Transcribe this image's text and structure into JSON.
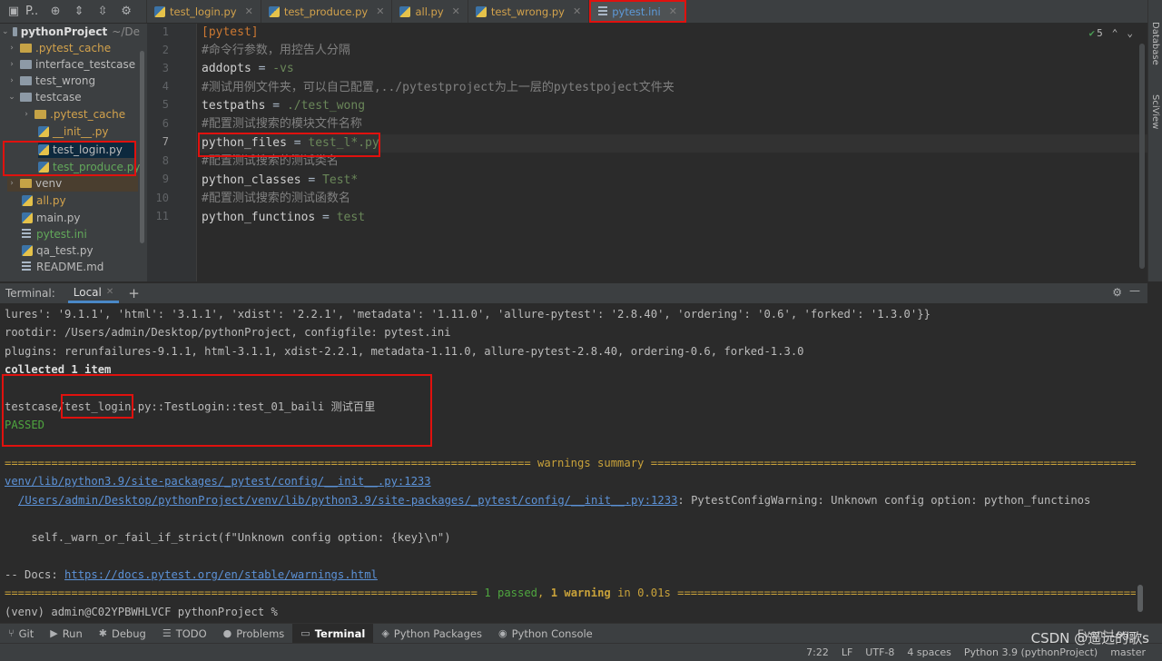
{
  "topbar": {
    "project_short": "P..",
    "tabs": [
      {
        "label": "test_login.py",
        "icon": "python-file-icon",
        "active": false
      },
      {
        "label": "test_produce.py",
        "icon": "python-file-icon",
        "active": false
      },
      {
        "label": "all.py",
        "icon": "python-file-icon",
        "active": false
      },
      {
        "label": "test_wrong.py",
        "icon": "python-file-icon",
        "active": false
      },
      {
        "label": "pytest.ini",
        "icon": "ini-file-icon",
        "active": true
      }
    ]
  },
  "right_strip": {
    "database": "Database",
    "sciview": "SciView"
  },
  "tree": {
    "root": "pythonProject",
    "root_path": "~/De",
    "items": [
      {
        "label": ".pytest_cache",
        "type": "folder-orange",
        "depth": 1,
        "expanded": false
      },
      {
        "label": "interface_testcase",
        "type": "folder",
        "depth": 1,
        "expanded": false
      },
      {
        "label": "test_wrong",
        "type": "folder",
        "depth": 1,
        "expanded": false
      },
      {
        "label": "testcase",
        "type": "folder",
        "depth": 1,
        "expanded": true
      },
      {
        "label": ".pytest_cache",
        "type": "folder-orange",
        "depth": 2,
        "expanded": false
      },
      {
        "label": "__init__.py",
        "type": "py",
        "depth": 2
      },
      {
        "label": "test_login.py",
        "type": "py",
        "depth": 2
      },
      {
        "label": "test_produce.py",
        "type": "py",
        "depth": 2
      },
      {
        "label": "venv",
        "type": "folder-orange",
        "depth": 1,
        "expanded": false
      },
      {
        "label": "all.py",
        "type": "py",
        "depth": 1
      },
      {
        "label": "main.py",
        "type": "py",
        "depth": 1
      },
      {
        "label": "pytest.ini",
        "type": "ini",
        "depth": 1
      },
      {
        "label": "qa_test.py",
        "type": "py",
        "depth": 1
      },
      {
        "label": "README.md",
        "type": "md",
        "depth": 1
      }
    ]
  },
  "editor": {
    "inspection_count": "5",
    "lines": [
      {
        "num": "1",
        "kind": "section",
        "text": "[pytest]"
      },
      {
        "num": "2",
        "kind": "comment",
        "text": "#命令行参数，用控告人分隔"
      },
      {
        "num": "3",
        "kind": "kv",
        "key": "addopts",
        "value": "-vs"
      },
      {
        "num": "4",
        "kind": "comment",
        "text": "#测试用例文件夹，可以自己配置,../pytestproject为上一层的pytestpoject文件夹"
      },
      {
        "num": "5",
        "kind": "kv",
        "key": "testpaths",
        "value": "./test_wong"
      },
      {
        "num": "6",
        "kind": "comment",
        "text": "#配置测试搜索的模块文件名称"
      },
      {
        "num": "7",
        "kind": "kv",
        "key": "python_files",
        "value": "test_l*.py"
      },
      {
        "num": "8",
        "kind": "comment",
        "text": "#配置测试搜索的测试类名"
      },
      {
        "num": "9",
        "kind": "kv",
        "key": "python_classes",
        "value": "Test*"
      },
      {
        "num": "10",
        "kind": "comment",
        "text": "#配置测试搜索的测试函数名"
      },
      {
        "num": "11",
        "kind": "kv",
        "key": "python_functinos",
        "value": "test"
      }
    ]
  },
  "terminal": {
    "label": "Terminal:",
    "tab": "Local",
    "lines": {
      "l1": "lures': '9.1.1', 'html': '3.1.1', 'xdist': '2.2.1', 'metadata': '1.11.0', 'allure-pytest': '2.8.40', 'ordering': '0.6', 'forked': '1.3.0'}}",
      "l2": "rootdir: /Users/admin/Desktop/pythonProject, configfile: pytest.ini",
      "l3": "plugins: rerunfailures-9.1.1, html-3.1.1, xdist-2.2.1, metadata-1.11.0, allure-pytest-2.8.40, ordering-0.6, forked-1.3.0",
      "l4": "collected 1 item",
      "l5_prefix": "testcase/",
      "l5_file": "test_login",
      "l5_rest": ".py::TestLogin::test_01_baili 测试百里",
      "l6": "PASSED",
      "warn_summary": "=============================================================================== warnings summary ===============================================================================",
      "warn_link1": "venv/lib/python3.9/site-packages/_pytest/config/__init__.py:1233",
      "warn_link2": "/Users/admin/Desktop/pythonProject/venv/lib/python3.9/site-packages/_pytest/config/__init__.py:1233",
      "warn_msg": ": PytestConfigWarning: Unknown config option: python_functinos",
      "warn_code": "    self._warn_or_fail_if_strict(f\"Unknown config option: {key}\\n\")",
      "docs_prefix": "-- Docs: ",
      "docs_link": "https://docs.pytest.org/en/stable/warnings.html",
      "result_left": "======================================================================= ",
      "result_passed": "1 passed",
      "result_comma": ", ",
      "result_warning": "1 warning",
      "result_time": " in 0.01s",
      "result_right": " ==========================================================================",
      "prompt": "(venv) admin@C02YPBWHLVCF pythonProject % "
    }
  },
  "bottom_tools": [
    {
      "label": "Git",
      "icon": "git-branch-icon"
    },
    {
      "label": "Run",
      "icon": "run-icon"
    },
    {
      "label": "Debug",
      "icon": "bug-icon"
    },
    {
      "label": "TODO",
      "icon": "todo-icon"
    },
    {
      "label": "Problems",
      "icon": "problems-icon"
    },
    {
      "label": "Terminal",
      "icon": "terminal-icon",
      "active": true
    },
    {
      "label": "Python Packages",
      "icon": "packages-icon"
    },
    {
      "label": "Python Console",
      "icon": "console-icon"
    }
  ],
  "event_log": "Event Log",
  "status": {
    "position": "7:22",
    "line_sep": "LF",
    "encoding": "UTF-8",
    "indent": "4 spaces",
    "interpreter": "Python 3.9 (pythonProject)",
    "branch": "master"
  },
  "watermark": "CSDN @遥远的歌s"
}
